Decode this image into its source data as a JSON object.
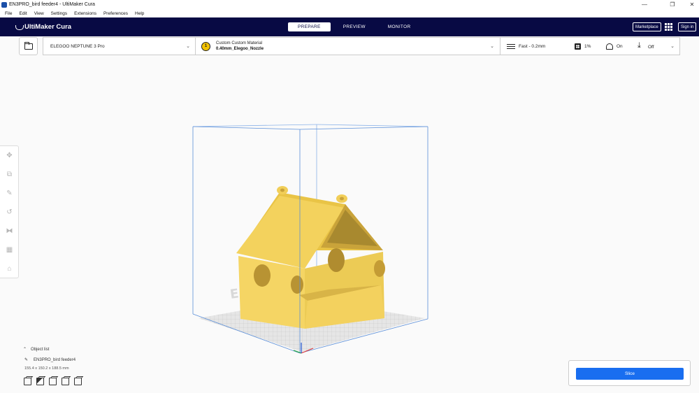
{
  "window": {
    "title": "EN3PRO_bird feeder4 - UltiMaker Cura",
    "controls": {
      "minimize": "—",
      "maximize": "❐",
      "close": "✕"
    }
  },
  "menu": [
    "File",
    "Edit",
    "View",
    "Settings",
    "Extensions",
    "Preferences",
    "Help"
  ],
  "header": {
    "logo": "UltiMaker Cura",
    "tabs": [
      "PREPARE",
      "PREVIEW",
      "MONITOR"
    ],
    "active_tab": "PREPARE",
    "marketplace": "Marketplace",
    "sign_in": "Sign in"
  },
  "printer": {
    "name": "ELEGOO NEPTUNE 3 Pro"
  },
  "material": {
    "extruder": "1",
    "line1": "Custom Custom Material",
    "line2": "0.40mm_Elegoo_Nozzle"
  },
  "print_settings": {
    "profile": "Fast - 0.2mm",
    "infill": "1%",
    "support": "On",
    "adhesion": "Off"
  },
  "tools": [
    "move-icon",
    "scale-icon",
    "mirror-icon",
    "rotate-icon",
    "mirror-flip-icon",
    "per-model-settings-icon",
    "support-blocker-icon"
  ],
  "object_list": {
    "label": "Object list",
    "object_name": "EN3PRO_bird feeder4",
    "dimensions": "155.4 x 150.2 x 188.5 mm"
  },
  "slice": {
    "label": "Slice"
  },
  "colors": {
    "header": "#080a44",
    "accent": "#196ef0",
    "model": "#f7d358",
    "build_volume": "#5b8fd9"
  }
}
